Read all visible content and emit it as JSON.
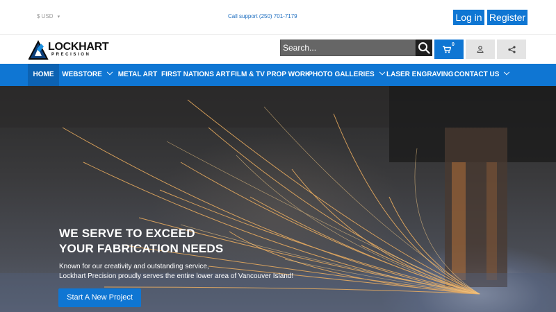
{
  "topbar": {
    "currency": "$ USD",
    "support": "Call support (250) 701-7179",
    "login": "Log in",
    "register": "Register"
  },
  "header": {
    "logo_name": "LOCKHART",
    "logo_sub": "PRECISION",
    "search_placeholder": "Search...",
    "cart_count": "0"
  },
  "nav": {
    "items": [
      {
        "label": "HOME",
        "active": true
      },
      {
        "label": "WEBSTORE"
      },
      {
        "label": "METAL ART"
      },
      {
        "label": "FIRST NATIONS ART"
      },
      {
        "label": "FILM & TV PROP WORK"
      },
      {
        "label": "PHOTO GALLERIES"
      },
      {
        "label": "LASER ENGRAVING"
      },
      {
        "label": "CONTACT US"
      }
    ]
  },
  "hero": {
    "title_line1": "WE SERVE TO EXCEED",
    "title_line2": "YOUR FABRICATION NEEDS",
    "text_line1": "Known for our creativity and outstanding service,",
    "text_line2": "Lockhart Precision proudly serves the entire lower area of Vancouver Island!",
    "cta": "Start A New Project"
  },
  "colors": {
    "brand_blue": "#0f76d3",
    "nav_active": "#0c62b2"
  },
  "icons": [
    "chevron-down-icon",
    "search-icon",
    "cart-icon",
    "user-icon",
    "share-icon",
    "logo-mark-icon"
  ]
}
